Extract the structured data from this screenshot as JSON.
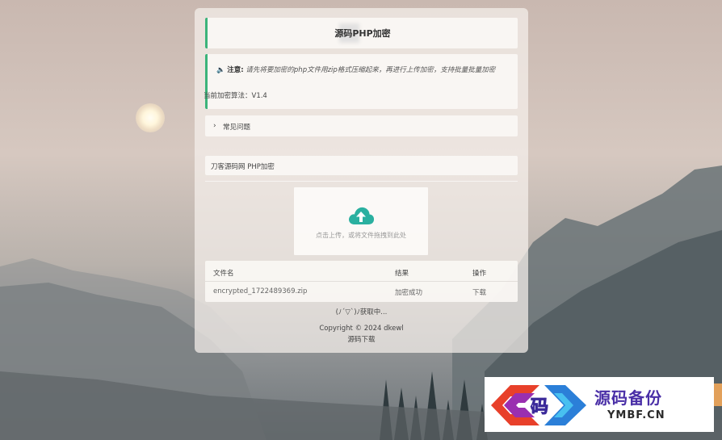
{
  "header": {
    "title": "源码PHP加密"
  },
  "notice": {
    "icon": "speaker-icon",
    "label": "注意:",
    "text": "请先将要加密的php文件用zip格式压缩起来，再进行上传加密，支持批量批量加密",
    "version": "当前加密算法：V1.4"
  },
  "faq": {
    "label": "常见问题"
  },
  "tool": {
    "label": "刀客源码网 PHP加密"
  },
  "upload": {
    "hint": "点击上传，或将文件拖拽到此处"
  },
  "table": {
    "headers": [
      "文件名",
      "结果",
      "操作"
    ],
    "rows": [
      {
        "filename": "encrypted_1722489369.zip",
        "result": "加密成功",
        "action": "下载"
      }
    ]
  },
  "status": {
    "fetching": "(ﾉ´▽`)ﾉ获取中..."
  },
  "footer": {
    "copyright": "Copyright © 2024 dkewl",
    "link": "源码下载"
  },
  "watermark": {
    "cn": "源码备份",
    "en": "YMBF.CN",
    "glyph": "码"
  },
  "colors": {
    "accent": "#3bb37a",
    "upload_icon": "#2ab0a0",
    "watermark_purple": "#4a2fa7"
  }
}
